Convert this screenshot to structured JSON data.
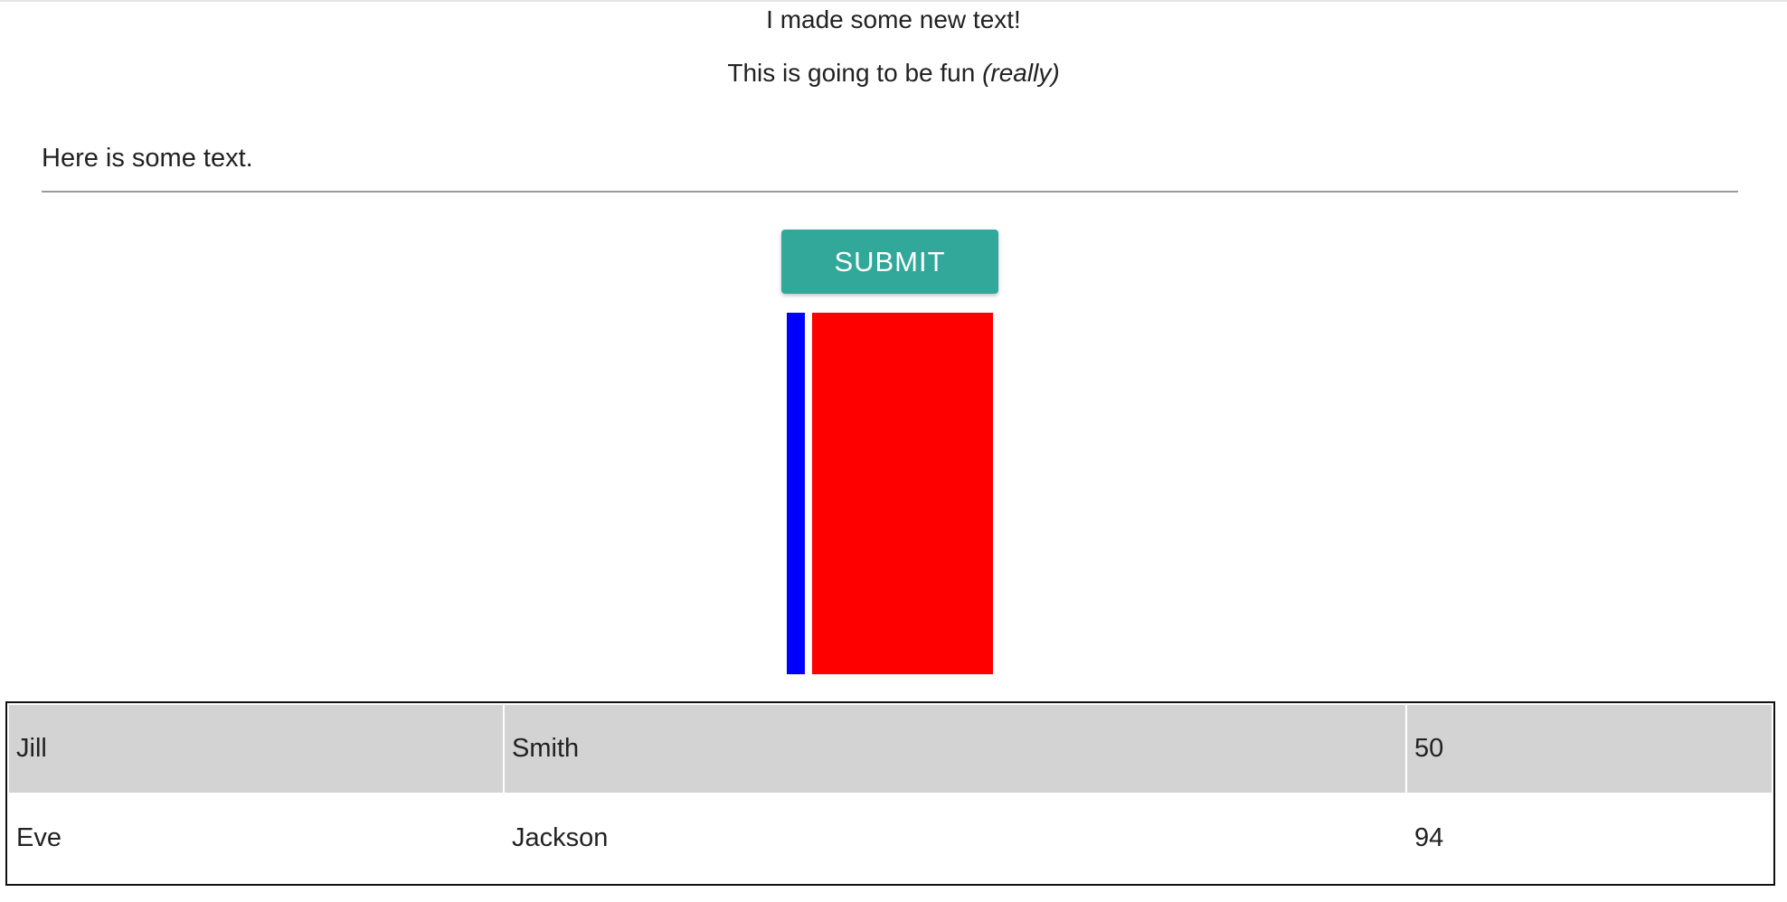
{
  "heading": {
    "line1": "I made some new text!",
    "line2_plain": "This is going to be fun",
    "line2_italic": "(really)"
  },
  "text_field": {
    "value": "Here is some text."
  },
  "submit": {
    "label": "Submit"
  },
  "colors": {
    "button_bg": "#31a89a",
    "bar_blue": "#0000ff",
    "bar_red": "#ff0000",
    "row_shade": "#d3d3d3"
  },
  "table": {
    "rows": [
      {
        "first": "Jill",
        "last": "Smith",
        "score": "50"
      },
      {
        "first": "Eve",
        "last": "Jackson",
        "score": "94"
      }
    ]
  }
}
